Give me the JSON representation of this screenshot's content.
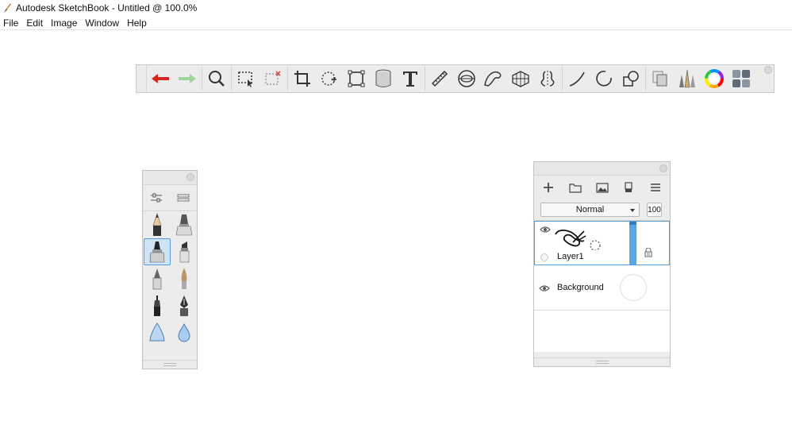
{
  "window": {
    "title": "Autodesk SketchBook - Untitled @ 100.0%"
  },
  "menubar": {
    "items": [
      "File",
      "Edit",
      "Image",
      "Window",
      "Help"
    ]
  },
  "toolbar": {
    "groups": [
      [
        "undo-icon",
        "redo-icon"
      ],
      [
        "zoom-icon"
      ],
      [
        "select-icon",
        "lasso-select-icon"
      ],
      [
        "crop-icon",
        "move-icon",
        "transform-icon",
        "fill-icon",
        "text-icon"
      ],
      [
        "ruler-icon",
        "ellipse-guide-icon",
        "french-curve-icon",
        "perspective-icon",
        "symmetry-icon"
      ],
      [
        "line-icon",
        "circle-icon",
        "shape-icon"
      ],
      [
        "copy-icon",
        "brushes-icon",
        "color-wheel-icon",
        "palette-grid-icon"
      ]
    ],
    "colors": {
      "undo": "#d7261e",
      "redo": "#9fd49a",
      "color_wheel": "#ff0000"
    }
  },
  "brush_palette": {
    "brushes": [
      "pencil-icon",
      "ink-pen-icon",
      "marker-icon",
      "chisel-marker-icon",
      "ballpoint-icon",
      "paintbrush-icon",
      "technical-pen-icon",
      "fountain-pen-icon",
      "airbrush-icon",
      "water-drop-icon",
      "cone-brush-icon",
      "eraser-icon"
    ],
    "selected_index": 2
  },
  "layer_panel": {
    "blend_mode": "Normal",
    "opacity": "100",
    "layers": [
      {
        "name": "Layer1",
        "visible": true,
        "active": true
      },
      {
        "name": "Background",
        "visible": true,
        "active": false
      }
    ]
  }
}
